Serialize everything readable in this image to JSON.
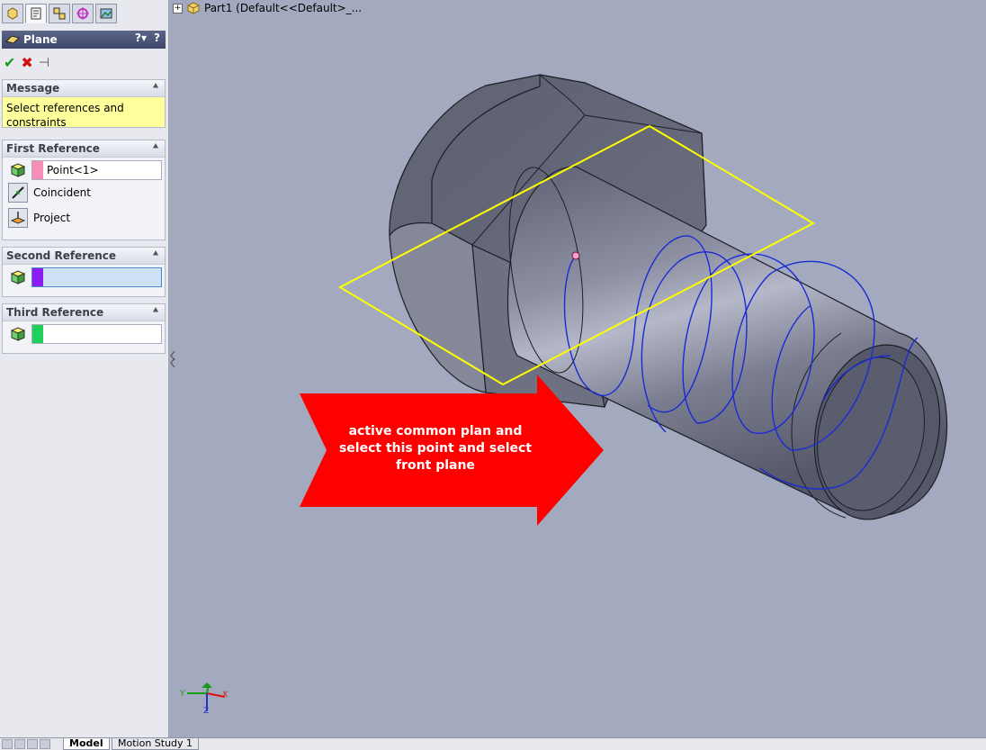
{
  "feature_manager": {
    "tabs": [
      "feature-manager",
      "property-manager",
      "configuration-manager",
      "dimxpert-manager",
      "display-manager"
    ],
    "header_title": "Plane",
    "header_help_1": "?▾",
    "header_help_2": "?",
    "actions": {
      "ok": "✔",
      "cancel": "✖",
      "pin": "⊣"
    }
  },
  "message_group": {
    "title": "Message",
    "text": "Select references and constraints"
  },
  "first_reference": {
    "title": "First Reference",
    "value": "Point<1>",
    "swatch_color": "#f58fb8",
    "options": [
      "Coincident",
      "Project"
    ]
  },
  "second_reference": {
    "title": "Second Reference",
    "value": "",
    "swatch_color": "#8a1cf0"
  },
  "third_reference": {
    "title": "Third Reference",
    "value": "",
    "swatch_color": "#1fd05a"
  },
  "tree": {
    "expander": "+",
    "label": "Part1  (Default<<Default>_..."
  },
  "annotation": {
    "text": "active common plan and select this point and select front plane",
    "color": "#ff0000"
  },
  "triad": {
    "x": "X",
    "y": "Y",
    "z": "Z"
  },
  "bottom_tabs": [
    "Model",
    "Motion Study 1"
  ]
}
